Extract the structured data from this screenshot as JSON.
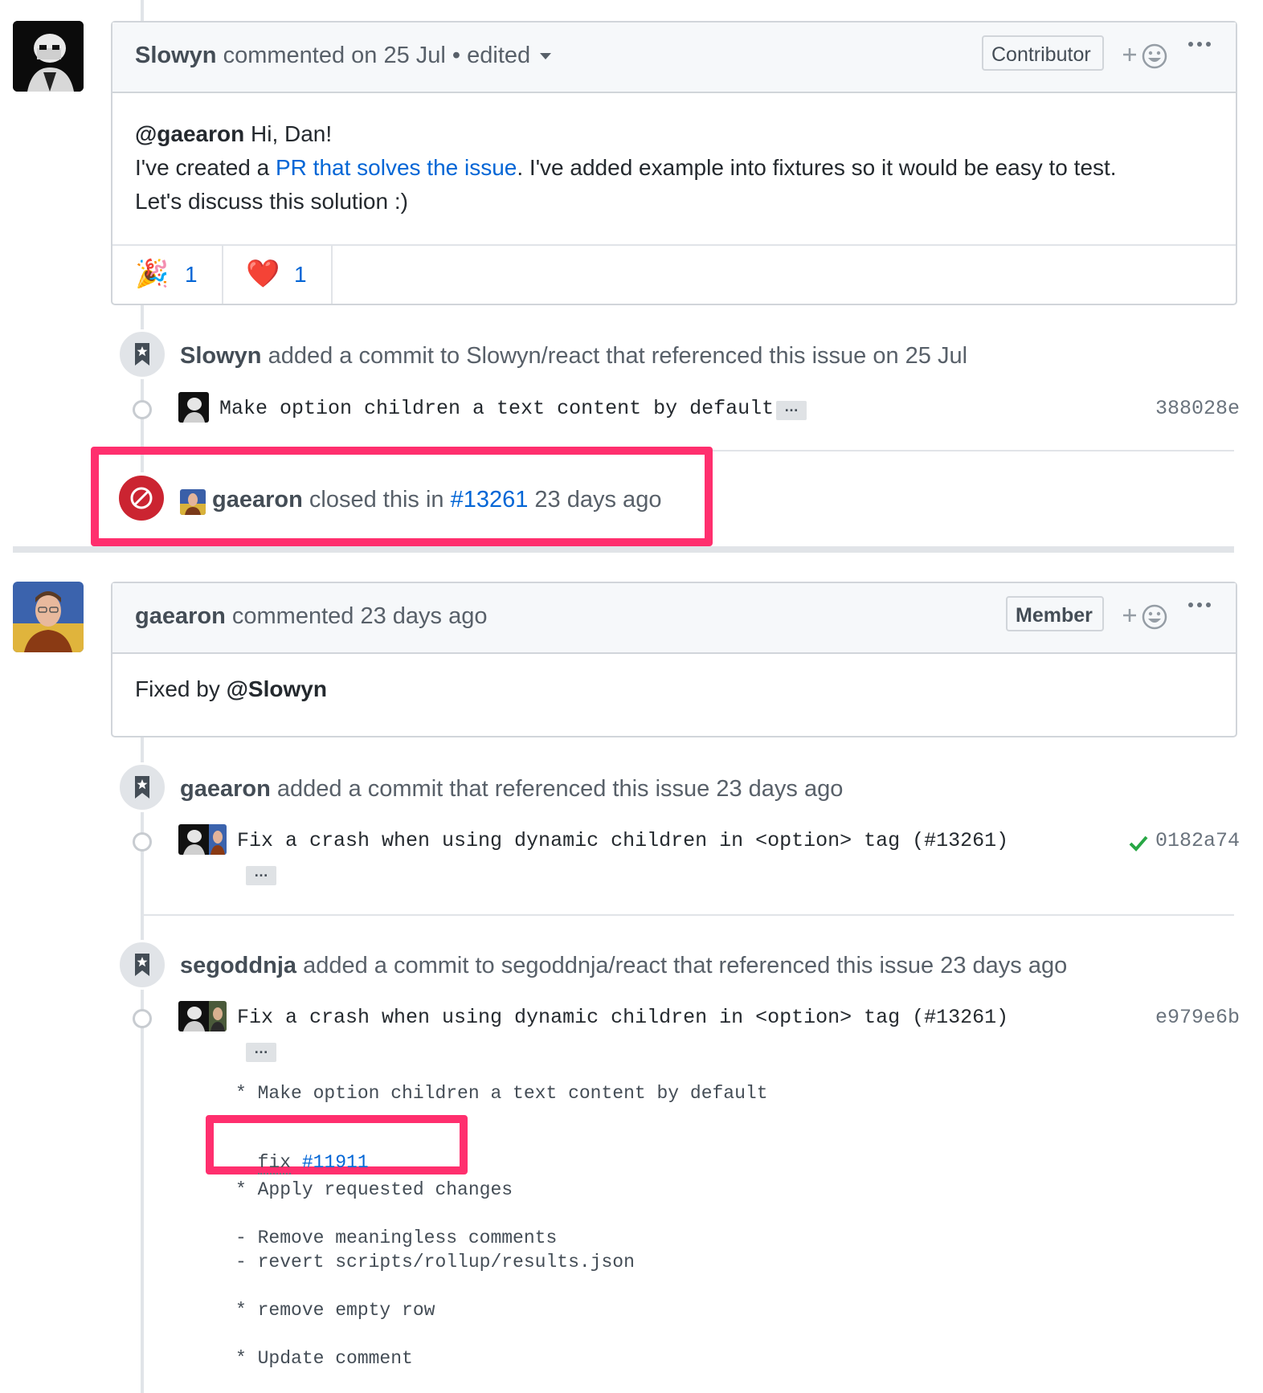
{
  "comment1": {
    "author": "Slowyn",
    "meta": "commented on 25 Jul • edited",
    "role": "Contributor",
    "body": {
      "mention": "@gaearon",
      "greeting": " Hi, Dan!",
      "line2_pre": "I've created a ",
      "line2_link": "PR that solves the issue",
      "line2_post": ". I've added example into fixtures so it would be easy to test.",
      "line3": "Let's discuss this solution :)"
    },
    "reactions": [
      {
        "icon": "party-popper-icon",
        "emoji": "🎉",
        "count": "1"
      },
      {
        "icon": "heart-icon",
        "emoji": "❤️",
        "count": "1"
      }
    ]
  },
  "event1": {
    "actor": "Slowyn",
    "text": " added a commit to Slowyn/react that referenced this issue on 25 Jul",
    "commit_message": "Make option children a text content by default",
    "ellipsis": "…",
    "sha": "388028e"
  },
  "event2": {
    "actor": "gaearon",
    "text_pre": " closed this in ",
    "link": "#13261",
    "text_post": " 23 days ago"
  },
  "comment2": {
    "author": "gaearon",
    "meta": "commented 23 days ago",
    "role": "Member",
    "body_pre": "Fixed by ",
    "body_mention": "@Slowyn"
  },
  "event3": {
    "actor": "gaearon",
    "text": " added a commit that referenced this issue 23 days ago",
    "commit_message": "Fix a crash when using dynamic children in <option> tag (#13261)",
    "ellipsis": "…",
    "status_icon": "check-icon",
    "sha": "0182a74"
  },
  "event4": {
    "actor": "segoddnja",
    "text": " added a commit to segoddnja/react that referenced this issue 23 days ago",
    "commit_message": "Fix a crash when using dynamic children in <option> tag (#13261)",
    "ellipsis": "…",
    "sha": "e979e6b",
    "description": {
      "line1": "* Make option children a text content by default",
      "fix_word": "fix",
      "fix_link": "#11911",
      "line3": "* Apply requested changes",
      "line4": "- Remove meaningless comments",
      "line5": "- revert scripts/rollup/results.json",
      "line6": "* remove empty row",
      "line7": "* Update comment"
    }
  },
  "colors": {
    "highlight": "#ff2f6e",
    "link": "#0366d6",
    "closed_red": "#cb2431",
    "success_green": "#28a745"
  }
}
